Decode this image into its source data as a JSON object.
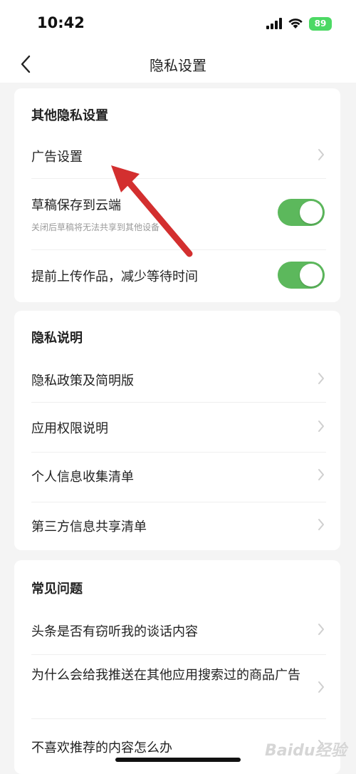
{
  "status": {
    "time": "10:42",
    "battery": "89"
  },
  "nav": {
    "title": "隐私设置"
  },
  "section_other": {
    "title": "其他隐私设置",
    "items": [
      {
        "label": "广告设置"
      },
      {
        "label": "草稿保存到云端",
        "sub": "关闭后草稿将无法共享到其他设备",
        "toggle": true
      },
      {
        "label": "提前上传作品，减少等待时间",
        "toggle": true
      }
    ]
  },
  "section_privacy": {
    "title": "隐私说明",
    "items": [
      {
        "label": "隐私政策及简明版"
      },
      {
        "label": "应用权限说明"
      },
      {
        "label": "个人信息收集清单"
      },
      {
        "label": "第三方信息共享清单"
      }
    ]
  },
  "section_faq": {
    "title": "常见问题",
    "items": [
      {
        "label": "头条是否有窃听我的谈话内容"
      },
      {
        "label": "为什么会给我推送在其他应用搜索过的商品广告"
      },
      {
        "label": "不喜欢推荐的内容怎么办"
      }
    ]
  },
  "watermark": {
    "text": "Baidu经验"
  },
  "colors": {
    "toggle_on": "#5cb85c",
    "annotation_arrow": "#d32f2f",
    "battery": "#4cd964"
  }
}
